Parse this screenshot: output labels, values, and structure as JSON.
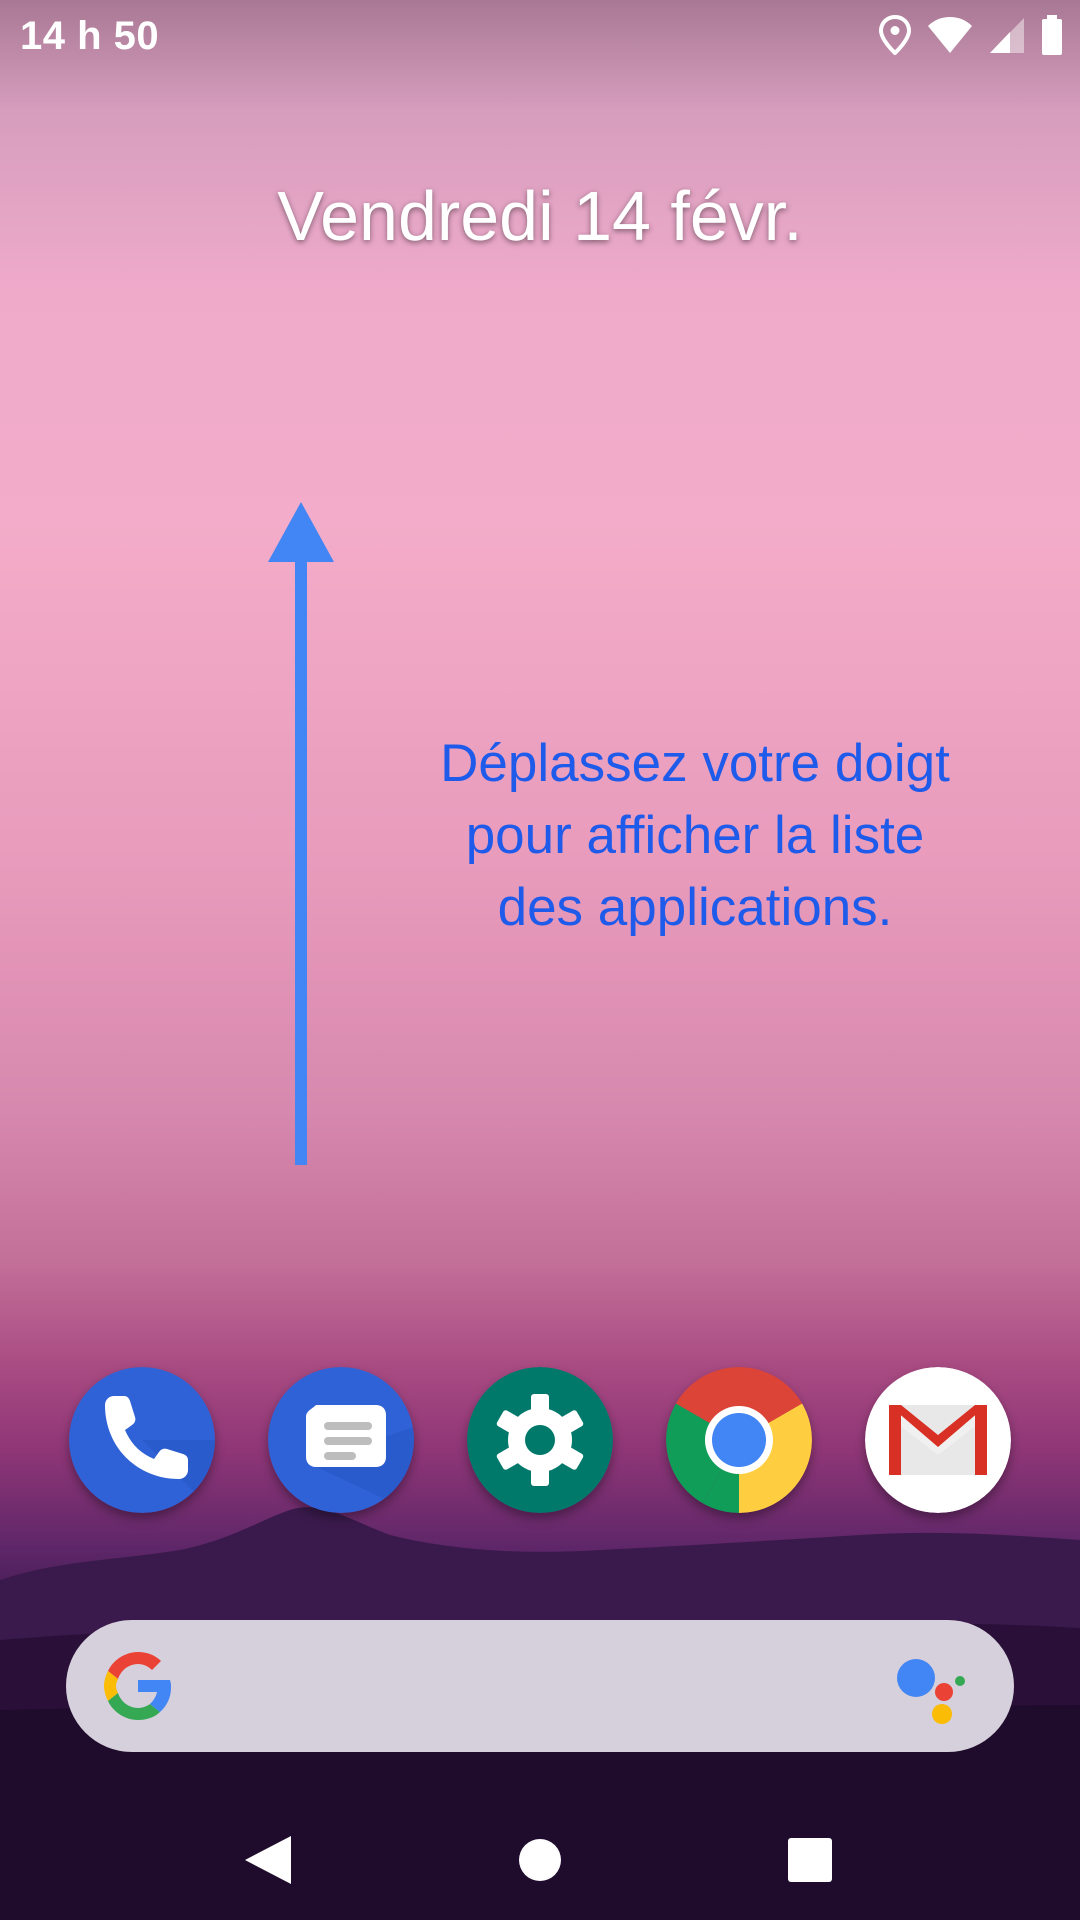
{
  "status_bar": {
    "time": "14 h 50",
    "icons": [
      "location-icon",
      "wifi-icon",
      "cellular-signal-icon",
      "battery-icon"
    ]
  },
  "home": {
    "date": "Vendredi 14 févr.",
    "swipe_hint": {
      "lines": [
        "Déplassez votre doigt",
        "pour afficher la liste",
        "des applications."
      ],
      "color": "#1f5bea",
      "arrow_color": "#4285f4",
      "arrow_direction": "up"
    }
  },
  "dock": {
    "apps": [
      {
        "name": "Téléphone",
        "icon": "phone-app-icon",
        "color": "#2f62d6"
      },
      {
        "name": "Messages",
        "icon": "messages-app-icon",
        "color": "#2f62d6"
      },
      {
        "name": "Paramètres",
        "icon": "settings-app-icon",
        "color": "#00796b"
      },
      {
        "name": "Chrome",
        "icon": "chrome-app-icon",
        "color": "#4285f4"
      },
      {
        "name": "Gmail",
        "icon": "gmail-app-icon",
        "color": "#d93025"
      }
    ]
  },
  "search_bar": {
    "left_icon": "google-g-icon",
    "right_icon": "google-assistant-icon",
    "background": "#d6d0dc"
  },
  "nav_bar": {
    "buttons": [
      "back-icon",
      "home-icon",
      "recents-icon"
    ]
  }
}
